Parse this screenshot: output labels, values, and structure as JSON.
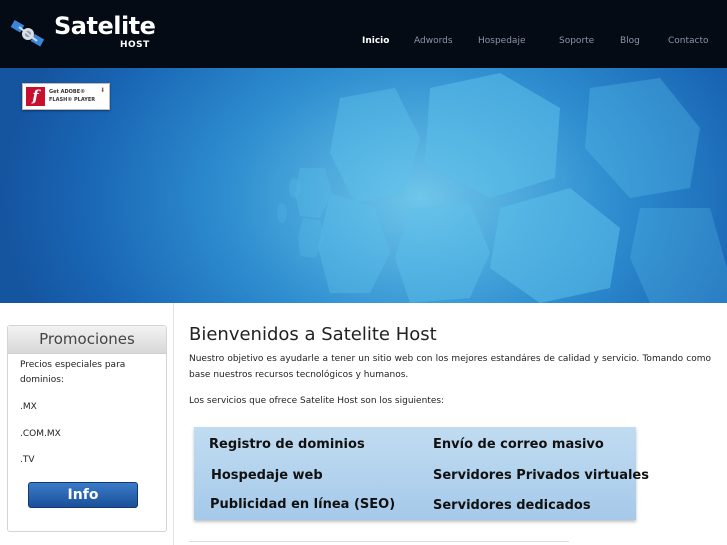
{
  "header": {
    "logo_title": "Satelite",
    "logo_sub": "HOST",
    "nav": [
      {
        "label": "Inicio",
        "active": true
      },
      {
        "label": "Adwords",
        "active": false
      },
      {
        "label": "Hospedaje",
        "active": false
      },
      {
        "label": "Soporte",
        "active": false
      },
      {
        "label": "Blog",
        "active": false
      },
      {
        "label": "Contacto",
        "active": false
      }
    ]
  },
  "banner": {
    "flash_badge": {
      "line1": "Get ADOBE®",
      "line2": "FLASH® PLAYER"
    }
  },
  "sidebar": {
    "promo_title": "Promociones",
    "promo_intro": "Precios especiales para dominios:",
    "promo_items": [
      ".MX",
      ".COM.MX",
      ".TV"
    ],
    "info_button": "Info"
  },
  "main": {
    "title": "Bienvenidos a Satelite Host",
    "intro": "Nuestro objetivo es ayudarle a tener un sitio web con los mejores estandáres de calidad y servicio. Tomando como base nuestros recursos tecnológicos y humanos.",
    "services_intro": "Los servicios que ofrece Satelite Host son los siguientes:",
    "services": [
      "Registro de dominios",
      "Envío de correo masivo",
      "Hospedaje web",
      "Servidores Privados virtuales",
      "Publicidad en línea (SEO)",
      "Servidores dedicados"
    ]
  },
  "colors": {
    "header_bg": "#050b14",
    "banner_blue": "#2f8fd0",
    "services_bg": "#b3d3ee",
    "info_button": "#1b4f9a"
  }
}
